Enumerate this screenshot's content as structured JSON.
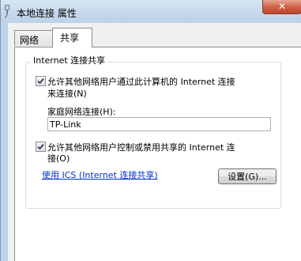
{
  "window": {
    "title": "本地连接 属性",
    "close_glyph": "✕"
  },
  "tabs": [
    {
      "label": "网络",
      "active": false
    },
    {
      "label": "共享",
      "active": true
    }
  ],
  "sharing": {
    "group_label": "Internet 连接共享",
    "allow_connect": {
      "checked": true,
      "line1": "允许其他网络用户通过此计算机的 Internet 连接",
      "line2": "来连接(N)"
    },
    "home_network_label": "家庭网络连接(H):",
    "home_network_value": "TP-Link",
    "allow_control": {
      "checked": true,
      "line1": "允许其他网络用户控制或禁用共享的 Internet 连",
      "line2": "接(O)"
    },
    "ics_link": "使用 ICS (Internet 连接共享)",
    "settings_button": "设置(G)..."
  },
  "icons": {
    "title_icon": "network-plug-icon",
    "checkmark": "checkmark-icon"
  }
}
